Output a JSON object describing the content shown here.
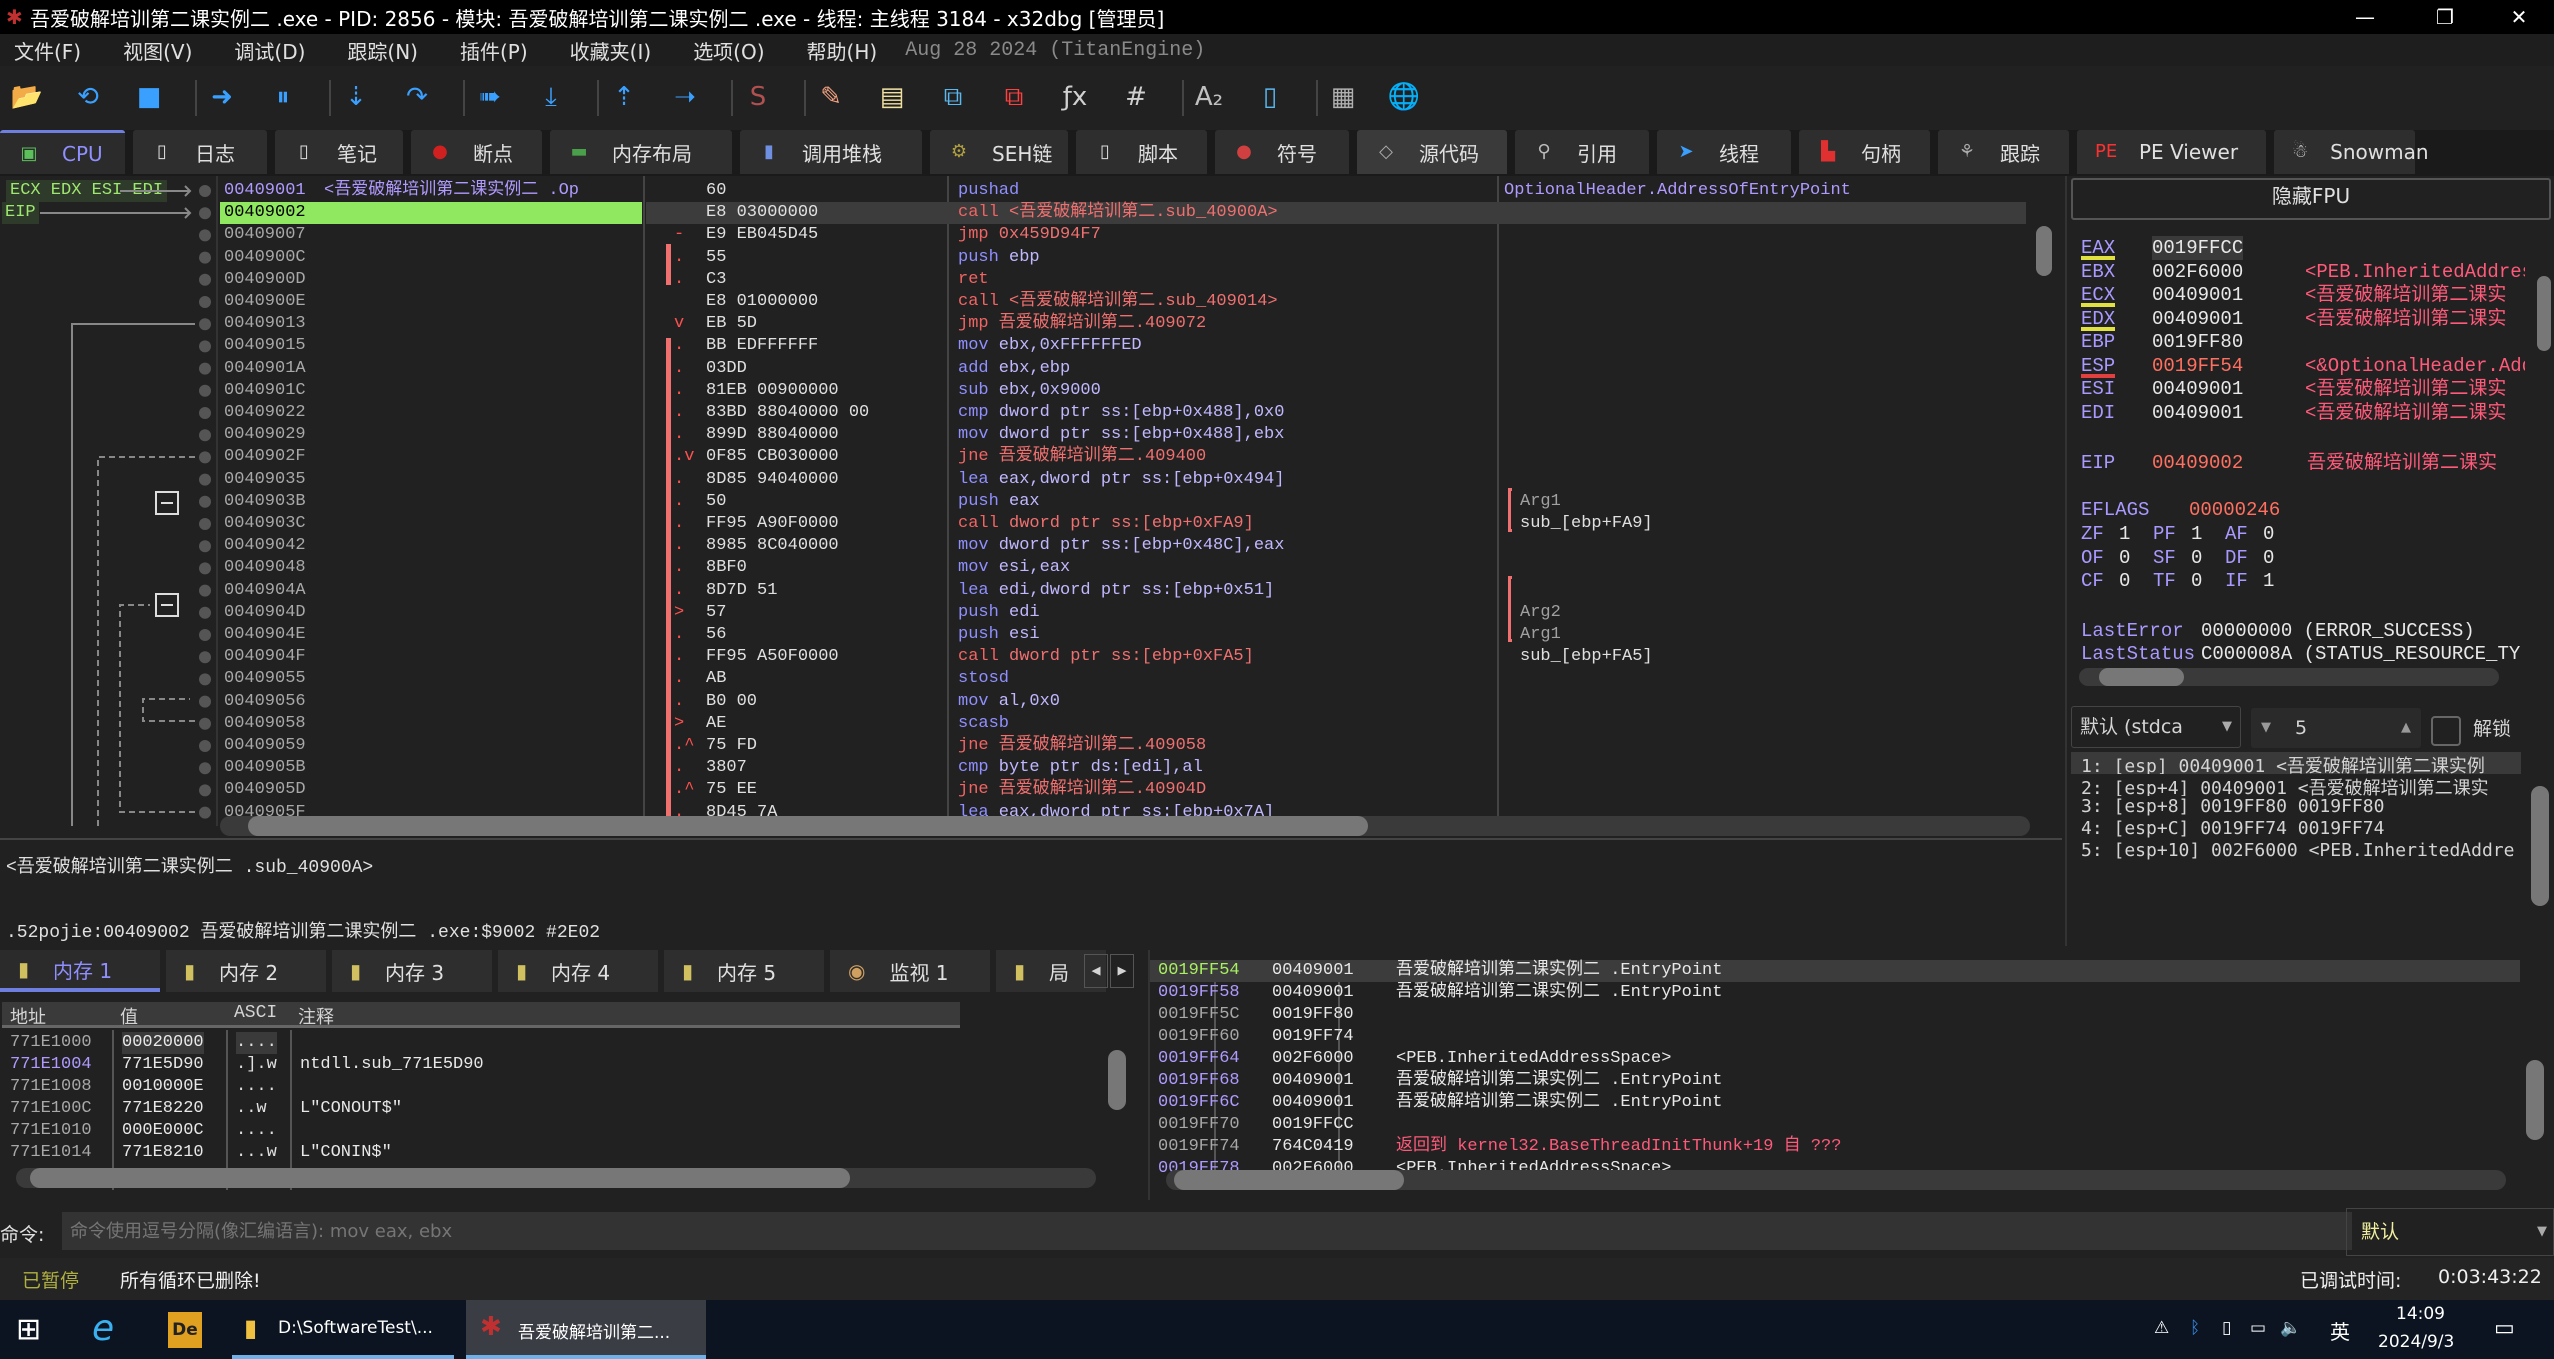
{
  "window": {
    "title": "吾爱破解培训第二课实例二 .exe - PID: 2856 - 模块: 吾爱破解培训第二课实例二 .exe - 线程: 主线程 3184 - x32dbg [管理员]",
    "minimize": "—",
    "maximize": "❐",
    "close": "✕"
  },
  "menu": {
    "items": [
      "文件(F)",
      "视图(V)",
      "调试(D)",
      "跟踪(N)",
      "插件(P)",
      "收藏夹(I)",
      "选项(O)",
      "帮助(H)"
    ],
    "version": "Aug 28 2024 (TitanEngine)"
  },
  "toolbar": [
    {
      "name": "open-icon",
      "glyph": "📂",
      "color": "#e8c070"
    },
    {
      "name": "restart-icon",
      "glyph": "⟲",
      "color": "#3aa0ff"
    },
    {
      "name": "stop-icon",
      "glyph": "■",
      "color": "#3aa0ff"
    },
    {
      "sep": true
    },
    {
      "name": "run-icon",
      "glyph": "➜",
      "color": "#3aa0ff"
    },
    {
      "name": "pause-icon",
      "glyph": "⏸",
      "color": "#3aa0ff"
    },
    {
      "sep": true
    },
    {
      "name": "step-into-icon",
      "glyph": "⇣",
      "color": "#3aa0ff"
    },
    {
      "name": "step-over-icon",
      "glyph": "↷",
      "color": "#3aa0ff"
    },
    {
      "sep": true
    },
    {
      "name": "trace-into-icon",
      "glyph": "➠",
      "color": "#3aa0ff"
    },
    {
      "name": "trace-over-icon",
      "glyph": "⤓",
      "color": "#3aa0ff"
    },
    {
      "sep": true
    },
    {
      "name": "execute-till-return-icon",
      "glyph": "⇡",
      "color": "#3aa0ff"
    },
    {
      "name": "run-to-user-code-icon",
      "glyph": "➝",
      "color": "#3aa0ff"
    },
    {
      "sep": true
    },
    {
      "name": "script-icon",
      "glyph": "S",
      "color": "#b05050"
    },
    {
      "sep": true
    },
    {
      "name": "patch-icon",
      "glyph": "✎",
      "color": "#f0a080"
    },
    {
      "name": "comments-icon",
      "glyph": "▤",
      "color": "#f0e0a0"
    },
    {
      "name": "labels-icon",
      "glyph": "⧉",
      "color": "#5ab8f0"
    },
    {
      "name": "bookmarks-icon",
      "glyph": "⧉",
      "color": "#ff4040"
    },
    {
      "name": "functions-icon",
      "glyph": "ƒx",
      "color": "#d0d0d0"
    },
    {
      "name": "hash-icon",
      "glyph": "#",
      "color": "#d0d0d0"
    },
    {
      "sep": true
    },
    {
      "name": "strings-icon",
      "glyph": "A₂",
      "color": "#c0c0c0"
    },
    {
      "name": "memory-map-icon",
      "glyph": "▯",
      "color": "#5ab8f0"
    },
    {
      "sep": true
    },
    {
      "name": "calculator-icon",
      "glyph": "▦",
      "color": "#b0b0b0"
    },
    {
      "name": "globe-icon",
      "glyph": "🌐",
      "color": "#3aa0ff"
    }
  ],
  "tabs": [
    {
      "label": "CPU",
      "icon": "cpu-icon",
      "glyph": "▣",
      "color": "#5cbf5c",
      "w": 78
    },
    {
      "label": "日志",
      "icon": "log-icon",
      "glyph": "▯",
      "color": "#dddddd",
      "w": 84
    },
    {
      "label": "笔记",
      "icon": "notes-icon",
      "glyph": "▯",
      "color": "#dddddd",
      "w": 80
    },
    {
      "label": "断点",
      "icon": "breakpoint-icon",
      "glyph": "●",
      "color": "#d02020",
      "w": 82
    },
    {
      "label": "内存布局",
      "icon": "memory-map-icon",
      "glyph": "▬",
      "color": "#4aa04a",
      "w": 114
    },
    {
      "label": "调用堆栈",
      "icon": "call-stack-icon",
      "glyph": "▮",
      "color": "#6f8fe0",
      "w": 114
    },
    {
      "label": "SEH链",
      "icon": "seh-icon",
      "glyph": "⚙",
      "color": "#b0a040",
      "w": 86
    },
    {
      "label": "脚本",
      "icon": "script-icon",
      "glyph": "▯",
      "color": "#dddddd",
      "w": 82
    },
    {
      "label": "符号",
      "icon": "symbols-icon",
      "glyph": "●",
      "color": "#d04040",
      "w": 84
    },
    {
      "label": "源代码",
      "icon": "source-icon",
      "glyph": "◇",
      "color": "#aaaaaa",
      "w": 94
    },
    {
      "label": "引用",
      "icon": "references-icon",
      "glyph": "⚲",
      "color": "#bbbbbb",
      "w": 84
    },
    {
      "label": "线程",
      "icon": "threads-icon",
      "glyph": "➤",
      "color": "#3aa0ff",
      "w": 84
    },
    {
      "label": "句柄",
      "icon": "handles-icon",
      "glyph": "▙",
      "color": "#e03030",
      "w": 82
    },
    {
      "label": "跟踪",
      "icon": "trace-icon",
      "glyph": "⚘",
      "color": "#aaaaaa",
      "w": 82
    },
    {
      "label": "PE Viewer",
      "icon": "pe-viewer-icon",
      "glyph": "PE",
      "color": "#ff3030",
      "w": 118
    },
    {
      "label": "Snowman",
      "icon": "snowman-icon",
      "glyph": "☃",
      "color": "#dddddd",
      "w": 88
    }
  ],
  "cpu": {
    "reg_labels": {
      "top": "ECX EDX ESI EDI",
      "eip": "EIP"
    },
    "rows": [
      {
        "addr": "00409001",
        "label": "<吾爱破解培训第二课实例二 .Op",
        "bytes": "60",
        "mark": "",
        "mn": "pushad",
        "ops": "",
        "comment": "OptionalHeader.AddressOfEntryPoint"
      },
      {
        "addr": "00409002",
        "bytes": "E8 03000000",
        "mark": "",
        "mn": "call",
        "ops": "<吾爱破解培训第二.sub_40900A>",
        "comment": "",
        "eip": true
      },
      {
        "addr": "00409007",
        "bytes": "E9 EB045D45",
        "mark": "-",
        "mn": "jmp",
        "ops": "0x459D94F7",
        "comment": ""
      },
      {
        "addr": "0040900C",
        "bytes": "55",
        "mark": ".",
        "mn": "push",
        "ops": "ebp",
        "comment": ""
      },
      {
        "addr": "0040900D",
        "bytes": "C3",
        "mark": ".",
        "mn": "ret",
        "ops": "",
        "comment": ""
      },
      {
        "addr": "0040900E",
        "bytes": "E8 01000000",
        "mark": "",
        "mn": "call",
        "ops": "<吾爱破解培训第二.sub_409014>",
        "comment": ""
      },
      {
        "addr": "00409013",
        "bytes": "EB 5D",
        "mark": "v",
        "mn": "jmp",
        "ops": "吾爱破解培训第二.409072",
        "comment": ""
      },
      {
        "addr": "00409015",
        "bytes": "BB EDFFFFFF",
        "mark": ".",
        "mn": "mov",
        "ops": "ebx,0xFFFFFFED",
        "comment": ""
      },
      {
        "addr": "0040901A",
        "bytes": "03DD",
        "mark": ".",
        "mn": "add",
        "ops": "ebx,ebp",
        "comment": ""
      },
      {
        "addr": "0040901C",
        "bytes": "81EB 00900000",
        "mark": ".",
        "mn": "sub",
        "ops": "ebx,0x9000",
        "comment": ""
      },
      {
        "addr": "00409022",
        "bytes": "83BD 88040000 00",
        "mark": ".",
        "mn": "cmp",
        "ops": "dword ptr  ss:[ebp+0x488],0x0",
        "comment": ""
      },
      {
        "addr": "00409029",
        "bytes": "899D 88040000",
        "mark": ".",
        "mn": "mov",
        "ops": "dword ptr  ss:[ebp+0x488],ebx",
        "comment": ""
      },
      {
        "addr": "0040902F",
        "bytes": "0F85 CB030000",
        "mark": ".v",
        "mn": "jne",
        "ops": "吾爱破解培训第二.409400",
        "comment": ""
      },
      {
        "addr": "00409035",
        "bytes": "8D85 94040000",
        "mark": ".",
        "mn": "lea",
        "ops": "eax,dword ptr  ss:[ebp+0x494]",
        "comment": ""
      },
      {
        "addr": "0040903B",
        "bytes": "50",
        "mark": ".",
        "mn": "push",
        "ops": "eax",
        "comment": "Arg1"
      },
      {
        "addr": "0040903C",
        "bytes": "FF95 A90F0000",
        "mark": ".",
        "mn": "call",
        "ops": "dword ptr  ss:[ebp+0xFA9]",
        "comment": "sub_[ebp+FA9]"
      },
      {
        "addr": "00409042",
        "bytes": "8985 8C040000",
        "mark": ".",
        "mn": "mov",
        "ops": "dword ptr  ss:[ebp+0x48C],eax",
        "comment": ""
      },
      {
        "addr": "00409048",
        "bytes": "8BF0",
        "mark": ".",
        "mn": "mov",
        "ops": "esi,eax",
        "comment": ""
      },
      {
        "addr": "0040904A",
        "bytes": "8D7D 51",
        "mark": ".",
        "mn": "lea",
        "ops": "edi,dword ptr  ss:[ebp+0x51]",
        "comment": ""
      },
      {
        "addr": "0040904D",
        "bytes": "57",
        "mark": ">",
        "mn": "push",
        "ops": "edi",
        "comment": "Arg2"
      },
      {
        "addr": "0040904E",
        "bytes": "56",
        "mark": ".",
        "mn": "push",
        "ops": "esi",
        "comment": "Arg1"
      },
      {
        "addr": "0040904F",
        "bytes": "FF95 A50F0000",
        "mark": ".",
        "mn": "call",
        "ops": "dword ptr  ss:[ebp+0xFA5]",
        "comment": "sub_[ebp+FA5]"
      },
      {
        "addr": "00409055",
        "bytes": "AB",
        "mark": ".",
        "mn": "stosd",
        "ops": "",
        "comment": ""
      },
      {
        "addr": "00409056",
        "bytes": "B0 00",
        "mark": ".",
        "mn": "mov",
        "ops": "al,0x0",
        "comment": ""
      },
      {
        "addr": "00409058",
        "bytes": "AE",
        "mark": ">",
        "mn": "scasb",
        "ops": "",
        "comment": ""
      },
      {
        "addr": "00409059",
        "bytes": "75 FD",
        "mark": ".^",
        "mn": "jne",
        "ops": "吾爱破解培训第二.409058",
        "comment": ""
      },
      {
        "addr": "0040905B",
        "bytes": "3807",
        "mark": ".",
        "mn": "cmp",
        "ops": "byte ptr  ds:[edi],al",
        "comment": ""
      },
      {
        "addr": "0040905D",
        "bytes": "75 EE",
        "mark": ".^",
        "mn": "jne",
        "ops": "吾爱破解培训第二.40904D",
        "comment": ""
      },
      {
        "addr": "0040905F",
        "bytes": "8D45 7A",
        "mark": ".",
        "mn": "lea",
        "ops": "eax,dword ptr  ss:[ebp+0x7A]",
        "comment": ""
      }
    ]
  },
  "info": {
    "line1": "<吾爱破解培训第二课实例二 .sub_40900A>",
    "line2": ".52pojie:00409002 吾爱破解培训第二课实例二 .exe:$9002 #2E02"
  },
  "registers": {
    "hide_fpu": "隐藏FPU",
    "gp": [
      {
        "name": "EAX",
        "value": "0019FFCC",
        "comment": "",
        "underline": "#e0e040"
      },
      {
        "name": "EBX",
        "value": "002F6000",
        "comment": "<PEB.InheritedAddres"
      },
      {
        "name": "ECX",
        "value": "00409001",
        "comment": "<吾爱破解培训第二课实",
        "underline": "#e0e040"
      },
      {
        "name": "EDX",
        "value": "00409001",
        "comment": "<吾爱破解培训第二课实",
        "underline": "#e0e040"
      },
      {
        "name": "EBP",
        "value": "0019FF80",
        "comment": ""
      },
      {
        "name": "ESP",
        "value": "0019FF54",
        "comment": "<&OptionalHeader.Add",
        "underline": "#e04040",
        "changed": true
      },
      {
        "name": "ESI",
        "value": "00409001",
        "comment": "<吾爱破解培训第二课实"
      },
      {
        "name": "EDI",
        "value": "00409001",
        "comment": "<吾爱破解培训第二课实"
      }
    ],
    "eip": {
      "name": "EIP",
      "value": "00409002",
      "comment": "吾爱破解培训第二课实"
    },
    "eflags": {
      "name": "EFLAGS",
      "value": "00000246"
    },
    "flags": [
      [
        "ZF",
        "1"
      ],
      [
        "PF",
        "1"
      ],
      [
        "AF",
        "0"
      ],
      [
        "OF",
        "0"
      ],
      [
        "SF",
        "0"
      ],
      [
        "DF",
        "0"
      ],
      [
        "CF",
        "0"
      ],
      [
        "TF",
        "0"
      ],
      [
        "IF",
        "1"
      ]
    ],
    "last_error": {
      "name": "LastError",
      "value": "00000000 (ERROR_SUCCESS)"
    },
    "last_status": {
      "name": "LastStatus",
      "value": "C000008A (STATUS_RESOURCE_TY"
    }
  },
  "callconv": {
    "convention": "默认 (stdca",
    "count": "5",
    "unlock_label": "解锁",
    "unlock_checked": false,
    "args": [
      "1: [esp] 00409001 <吾爱破解培训第二课实例",
      "2: [esp+4] 00409001 <吾爱破解培训第二课实",
      "3: [esp+8] 0019FF80 0019FF80",
      "4: [esp+C] 0019FF74 0019FF74",
      "5: [esp+10] 002F6000 <PEB.InheritedAddre"
    ]
  },
  "memory": {
    "tabs": [
      "内存 1",
      "内存 2",
      "内存 3",
      "内存 4",
      "内存 5",
      "监视 1",
      "局"
    ],
    "headers": [
      "地址",
      "值",
      "ASCI",
      "注释"
    ],
    "rows": [
      {
        "addr": "771E1000",
        "value": "00020000",
        "ascii": "....",
        "comment": ""
      },
      {
        "addr": "771E1004",
        "value": "771E5D90",
        "ascii": ".].w",
        "comment": "ntdll.sub_771E5D90",
        "hl": true
      },
      {
        "addr": "771E1008",
        "value": "0010000E",
        "ascii": "....",
        "comment": ""
      },
      {
        "addr": "771E100C",
        "value": "771E8220",
        "ascii": "..w",
        "comment": "L\"CONOUT$\""
      },
      {
        "addr": "771E1010",
        "value": "000E000C",
        "ascii": "....",
        "comment": ""
      },
      {
        "addr": "771E1014",
        "value": "771E8210",
        "ascii": "...w",
        "comment": "L\"CONIN$\""
      }
    ]
  },
  "stack": {
    "rows": [
      {
        "addr": "0019FF54",
        "value": "00409001",
        "comment": "吾爱破解培训第二课实例二 .EntryPoint",
        "kind": "top"
      },
      {
        "addr": "0019FF58",
        "value": "00409001",
        "comment": "吾爱破解培训第二课实例二 .EntryPoint",
        "kind": "ptr"
      },
      {
        "addr": "0019FF5C",
        "value": "0019FF80",
        "comment": "",
        "kind": ""
      },
      {
        "addr": "0019FF60",
        "value": "0019FF74",
        "comment": "",
        "kind": ""
      },
      {
        "addr": "0019FF64",
        "value": "002F6000",
        "comment": "<PEB.InheritedAddressSpace>",
        "kind": "ptr"
      },
      {
        "addr": "0019FF68",
        "value": "00409001",
        "comment": "吾爱破解培训第二课实例二 .EntryPoint",
        "kind": "ptr"
      },
      {
        "addr": "0019FF6C",
        "value": "00409001",
        "comment": "吾爱破解培训第二课实例二 .EntryPoint",
        "kind": "ptr"
      },
      {
        "addr": "0019FF70",
        "value": "0019FFCC",
        "comment": "",
        "kind": ""
      },
      {
        "addr": "0019FF74",
        "value": "764C0419",
        "comment": "返回到 kernel32.BaseThreadInitThunk+19 自 ???",
        "kind": "ret"
      },
      {
        "addr": "0019FF78",
        "value": "002F6000",
        "comment": "<PEB.InheritedAddressSpace>",
        "kind": "ptr"
      }
    ]
  },
  "command": {
    "label": "命令:",
    "placeholder": "命令使用逗号分隔(像汇编语言): mov eax, ebx",
    "mode": "默认"
  },
  "status": {
    "state": "已暂停",
    "message": "所有循环已删除!",
    "time_label": "已调试时间:",
    "time": "0:03:43:22"
  },
  "taskbar": {
    "items": [
      {
        "label": "D:\\SoftwareTest\\..."
      },
      {
        "label": "吾爱破解培训第二..."
      }
    ],
    "ime": "英",
    "clock": "14:09",
    "date": "2024/9/3"
  },
  "colors": {
    "eip_bg": "#8fe860",
    "mn_normal": "#8f8fff",
    "mn_branch": "#f06464",
    "accent": "#6f7fe0"
  }
}
